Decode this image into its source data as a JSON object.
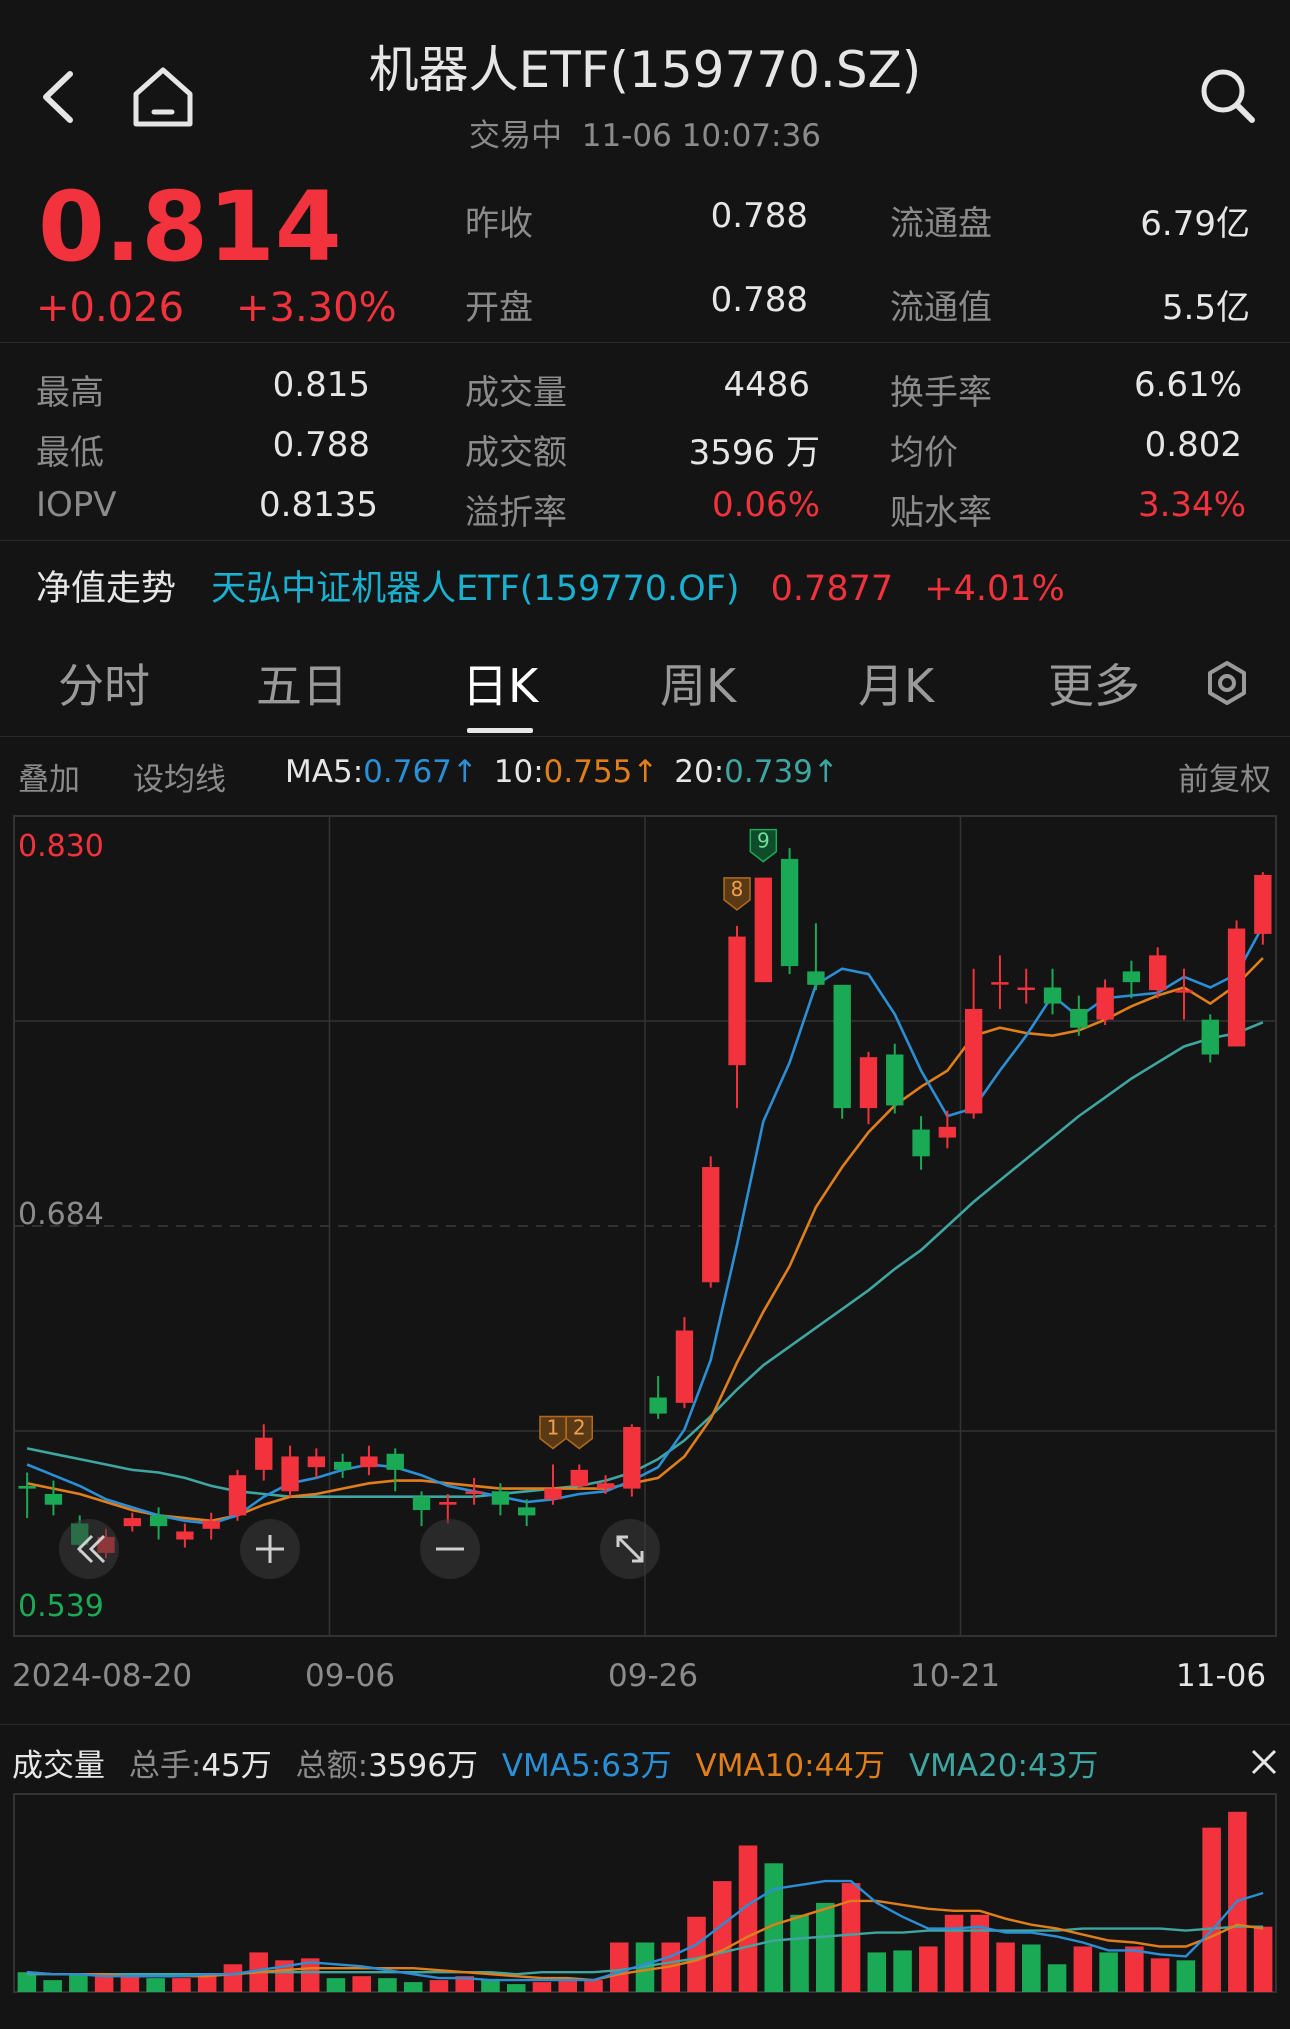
{
  "header": {
    "title": "机器人ETF(159770.SZ)",
    "status": "交易中",
    "datetime": "11-06 10:07:36"
  },
  "quote": {
    "price": "0.814",
    "change": "+0.026",
    "change_pct": "+3.30%",
    "prev_close_label": "昨收",
    "prev_close": "0.788",
    "open_label": "开盘",
    "open": "0.788",
    "float_shares_label": "流通盘",
    "float_shares": "6.79亿",
    "float_value_label": "流通值",
    "float_value": "5.5亿",
    "high_label": "最高",
    "high": "0.815",
    "low_label": "最低",
    "low": "0.788",
    "iopv_label": "IOPV",
    "iopv": "0.8135",
    "volume_label": "成交量",
    "volume": "4486",
    "amount_label": "成交额",
    "amount": "3596 万",
    "premium_label": "溢折率",
    "premium": "0.06%",
    "turnover_label": "换手率",
    "turnover": "6.61%",
    "avg_label": "均价",
    "avg": "0.802",
    "discount_label": "贴水率",
    "discount": "3.34%"
  },
  "nav": {
    "label": "净值走势",
    "fund_name": "天弘中证机器人ETF(159770.OF)",
    "value": "0.7877",
    "change_pct": "+4.01%"
  },
  "tabs": [
    "分时",
    "五日",
    "日K",
    "周K",
    "月K",
    "更多"
  ],
  "active_tab": "日K",
  "toolbar": {
    "overlay": "叠加",
    "set_ma": "设均线",
    "ma5_label": "MA5",
    "ma5_value": "0.767",
    "ma10_label": "10",
    "ma10_value": "0.755",
    "ma20_label": "20",
    "ma20_value": "0.739",
    "arrow": "↑",
    "adjust": "前复权"
  },
  "colors": {
    "up": "#f2333d",
    "down": "#1aaa55",
    "ma5": "#2a8fd6",
    "ma10": "#e07e1b",
    "ma20": "#3fa5a0"
  },
  "chart_data": {
    "type": "candlestick",
    "ylim": [
      0.53,
      0.836
    ],
    "y_labels": {
      "max": "0.830",
      "mid": "0.684",
      "min": "0.539"
    },
    "x_ticks": [
      "2024-08-20",
      "09-06",
      "09-26",
      "10-21",
      "11-06"
    ],
    "markers": [
      {
        "label": "1",
        "index": 20
      },
      {
        "label": "2",
        "index": 21
      },
      {
        "label": "8",
        "index": 27
      },
      {
        "label": "9",
        "index": 28
      }
    ],
    "candles": [
      [
        0.586,
        0.585,
        0.591,
        0.574
      ],
      [
        0.583,
        0.579,
        0.588,
        0.575
      ],
      [
        0.572,
        0.564,
        0.575,
        0.561
      ],
      [
        0.561,
        0.567,
        0.57,
        0.559
      ],
      [
        0.571,
        0.574,
        0.576,
        0.569
      ],
      [
        0.575,
        0.571,
        0.578,
        0.566
      ],
      [
        0.566,
        0.569,
        0.572,
        0.563
      ],
      [
        0.57,
        0.573,
        0.576,
        0.566
      ],
      [
        0.575,
        0.59,
        0.592,
        0.573
      ],
      [
        0.592,
        0.604,
        0.609,
        0.588
      ],
      [
        0.584,
        0.597,
        0.601,
        0.582
      ],
      [
        0.593,
        0.597,
        0.6,
        0.589
      ],
      [
        0.595,
        0.592,
        0.598,
        0.589
      ],
      [
        0.593,
        0.597,
        0.601,
        0.59
      ],
      [
        0.598,
        0.592,
        0.6,
        0.584
      ],
      [
        0.582,
        0.577,
        0.584,
        0.571
      ],
      [
        0.579,
        0.58,
        0.583,
        0.572
      ],
      [
        0.583,
        0.584,
        0.589,
        0.579
      ],
      [
        0.584,
        0.579,
        0.587,
        0.575
      ],
      [
        0.578,
        0.575,
        0.581,
        0.571
      ],
      [
        0.581,
        0.585,
        0.594,
        0.579
      ],
      [
        0.586,
        0.592,
        0.594,
        0.585
      ],
      [
        0.585,
        0.587,
        0.59,
        0.583
      ],
      [
        0.585,
        0.608,
        0.609,
        0.582
      ],
      [
        0.619,
        0.613,
        0.627,
        0.611
      ],
      [
        0.617,
        0.644,
        0.649,
        0.615
      ],
      [
        0.662,
        0.705,
        0.709,
        0.66
      ],
      [
        0.743,
        0.791,
        0.795,
        0.727
      ],
      [
        0.774,
        0.813,
        0.813,
        0.774
      ],
      [
        0.82,
        0.78,
        0.824,
        0.777
      ],
      [
        0.778,
        0.773,
        0.796,
        0.771
      ],
      [
        0.773,
        0.727,
        0.773,
        0.723
      ],
      [
        0.727,
        0.746,
        0.748,
        0.721
      ],
      [
        0.747,
        0.728,
        0.751,
        0.725
      ],
      [
        0.719,
        0.709,
        0.724,
        0.704
      ],
      [
        0.716,
        0.72,
        0.726,
        0.712
      ],
      [
        0.725,
        0.764,
        0.779,
        0.723
      ],
      [
        0.774,
        0.774,
        0.784,
        0.764
      ],
      [
        0.772,
        0.772,
        0.779,
        0.766
      ],
      [
        0.772,
        0.766,
        0.779,
        0.762
      ],
      [
        0.764,
        0.757,
        0.769,
        0.754
      ],
      [
        0.76,
        0.772,
        0.775,
        0.758
      ],
      [
        0.778,
        0.774,
        0.782,
        0.768
      ],
      [
        0.771,
        0.784,
        0.787,
        0.768
      ],
      [
        0.771,
        0.771,
        0.779,
        0.76
      ],
      [
        0.76,
        0.747,
        0.762,
        0.744
      ],
      [
        0.75,
        0.794,
        0.797,
        0.75
      ],
      [
        0.792,
        0.814,
        0.815,
        0.788
      ]
    ],
    "ma5": [
      0.594,
      0.59,
      0.586,
      0.581,
      0.578,
      0.575,
      0.573,
      0.572,
      0.575,
      0.582,
      0.587,
      0.589,
      0.592,
      0.594,
      0.593,
      0.59,
      0.586,
      0.584,
      0.582,
      0.58,
      0.581,
      0.583,
      0.584,
      0.588,
      0.593,
      0.607,
      0.633,
      0.676,
      0.722,
      0.744,
      0.773,
      0.779,
      0.777,
      0.762,
      0.741,
      0.724,
      0.727,
      0.741,
      0.754,
      0.769,
      0.761,
      0.768,
      0.769,
      0.77,
      0.776,
      0.772,
      0.777,
      0.795
    ],
    "ma10": [
      0.587,
      0.585,
      0.583,
      0.58,
      0.577,
      0.575,
      0.574,
      0.573,
      0.575,
      0.579,
      0.582,
      0.583,
      0.585,
      0.587,
      0.588,
      0.588,
      0.587,
      0.586,
      0.585,
      0.585,
      0.585,
      0.585,
      0.585,
      0.587,
      0.589,
      0.597,
      0.611,
      0.632,
      0.651,
      0.668,
      0.69,
      0.705,
      0.718,
      0.728,
      0.735,
      0.741,
      0.754,
      0.757,
      0.755,
      0.754,
      0.756,
      0.76,
      0.765,
      0.769,
      0.772,
      0.766,
      0.773,
      0.783
    ],
    "ma20": [
      0.6,
      0.598,
      0.596,
      0.594,
      0.592,
      0.591,
      0.589,
      0.586,
      0.584,
      0.583,
      0.582,
      0.582,
      0.582,
      0.582,
      0.582,
      0.582,
      0.582,
      0.582,
      0.583,
      0.584,
      0.585,
      0.586,
      0.588,
      0.591,
      0.596,
      0.603,
      0.612,
      0.622,
      0.631,
      0.638,
      0.645,
      0.652,
      0.659,
      0.667,
      0.674,
      0.683,
      0.692,
      0.7,
      0.708,
      0.716,
      0.724,
      0.731,
      0.738,
      0.744,
      0.75,
      0.753,
      0.755,
      0.759
    ]
  },
  "volume": {
    "title": "成交量",
    "total_lots_label": "总手",
    "total_lots": "45万",
    "total_amount_label": "总额",
    "total_amount": "3596万",
    "vma5_label": "VMA5",
    "vma5": "63万",
    "vma10_label": "VMA10",
    "vma10": "44万",
    "vma20_label": "VMA20",
    "vma20": "43万",
    "bars": [
      0.1,
      0.06,
      0.09,
      0.09,
      0.09,
      0.07,
      0.07,
      0.09,
      0.14,
      0.2,
      0.16,
      0.17,
      0.07,
      0.08,
      0.07,
      0.05,
      0.06,
      0.08,
      0.06,
      0.04,
      0.05,
      0.06,
      0.06,
      0.25,
      0.25,
      0.25,
      0.38,
      0.56,
      0.74,
      0.65,
      0.39,
      0.45,
      0.55,
      0.2,
      0.21,
      0.23,
      0.39,
      0.39,
      0.25,
      0.24,
      0.14,
      0.23,
      0.2,
      0.23,
      0.17,
      0.16,
      0.83,
      0.91,
      0.33
    ],
    "vma5_line": [
      0.1,
      0.09,
      0.09,
      0.08,
      0.08,
      0.08,
      0.08,
      0.09,
      0.09,
      0.11,
      0.13,
      0.15,
      0.14,
      0.13,
      0.11,
      0.09,
      0.07,
      0.07,
      0.06,
      0.06,
      0.06,
      0.06,
      0.06,
      0.1,
      0.14,
      0.18,
      0.24,
      0.34,
      0.44,
      0.52,
      0.54,
      0.56,
      0.56,
      0.45,
      0.38,
      0.32,
      0.32,
      0.33,
      0.3,
      0.3,
      0.28,
      0.25,
      0.21,
      0.21,
      0.19,
      0.18,
      0.31,
      0.46,
      0.5
    ],
    "vma10_line": [
      0.1,
      0.09,
      0.09,
      0.09,
      0.08,
      0.08,
      0.08,
      0.08,
      0.09,
      0.1,
      0.11,
      0.12,
      0.12,
      0.12,
      0.12,
      0.12,
      0.11,
      0.1,
      0.09,
      0.08,
      0.07,
      0.07,
      0.06,
      0.09,
      0.11,
      0.13,
      0.16,
      0.21,
      0.28,
      0.34,
      0.38,
      0.42,
      0.46,
      0.46,
      0.44,
      0.42,
      0.41,
      0.41,
      0.37,
      0.34,
      0.32,
      0.29,
      0.26,
      0.25,
      0.23,
      0.23,
      0.28,
      0.34,
      0.32
    ],
    "vma20_line": [
      0.09,
      0.09,
      0.09,
      0.09,
      0.09,
      0.09,
      0.09,
      0.09,
      0.09,
      0.1,
      0.1,
      0.1,
      0.1,
      0.1,
      0.1,
      0.1,
      0.1,
      0.1,
      0.1,
      0.09,
      0.1,
      0.1,
      0.1,
      0.11,
      0.13,
      0.15,
      0.17,
      0.2,
      0.23,
      0.26,
      0.27,
      0.28,
      0.29,
      0.3,
      0.3,
      0.31,
      0.31,
      0.31,
      0.31,
      0.31,
      0.31,
      0.32,
      0.32,
      0.32,
      0.32,
      0.31,
      0.32,
      0.33,
      0.33
    ],
    "ymax": 1.0
  }
}
